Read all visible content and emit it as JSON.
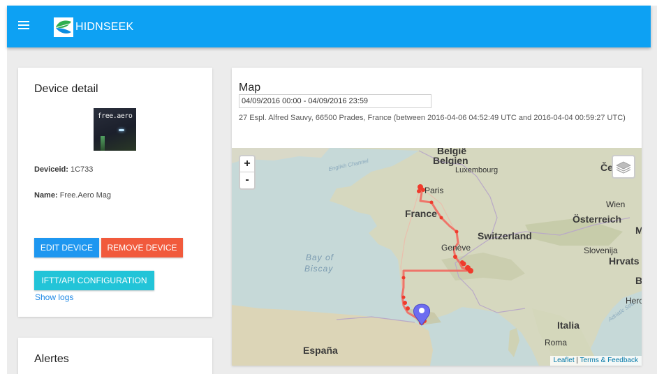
{
  "app": {
    "brand": "HIDNSEEK",
    "brand_color": "#0da1f3"
  },
  "device": {
    "title": "Device detail",
    "image_text": "free.aero",
    "deviceid_label": "Deviceid:",
    "deviceid_value": "1C733",
    "name_label": "Name:",
    "name_value": "Free.Aero Mag",
    "edit_label": "EDIT DEVICE",
    "remove_label": "REMOVE DEVICE",
    "ifttt_label": "IFTT/API CONFIGURATION",
    "logs_label": "Show logs"
  },
  "alerts": {
    "title": "Alertes"
  },
  "map": {
    "title": "Map",
    "date_range": "04/09/2016 00:00 - 04/09/2016 23:59",
    "address": "27 Espl. Alfred Sauvy, 66500 Prades, France (between 2016-04-06 04:52:49 UTC and 2016-04-04 00:59:27 UTC)",
    "zoom_in": "+",
    "zoom_out": "-",
    "attribution_leaflet": "Leaflet",
    "attribution_sep": " | ",
    "attribution_terms": "Terms & Feedback",
    "track_color": "#f2645a",
    "marker_color": "#6d6cf0",
    "labels": {
      "belgie": "België",
      "belgien": "Belgien",
      "luxembourg": "Luxembourg",
      "english_channel": "English Channel",
      "paris": "Paris",
      "france": "France",
      "wien": "Wien",
      "osterreich": "Österreich",
      "switzerland": "Switzerland",
      "geneve": "Genève",
      "slovenija": "Slovenija",
      "hrvats": "Hrvats",
      "bay": "Bay of",
      "biscay": "Biscay",
      "adriatic": "Adriatic Sea",
      "italia": "Italia",
      "roma": "Roma",
      "espana": "España",
      "ce": "Če",
      "m": "M",
      "b": "B",
      "her": "Herc"
    }
  }
}
